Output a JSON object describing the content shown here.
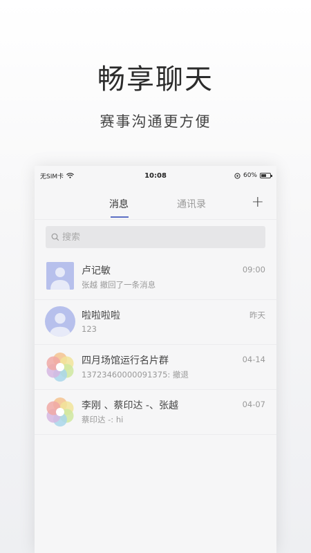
{
  "promo": {
    "title": "畅享聊天",
    "subtitle": "赛事沟通更方便"
  },
  "status_bar": {
    "carrier": "无SIM卡",
    "time": "10:08",
    "battery": "60%",
    "battery_level": 0.6
  },
  "tabs": {
    "messages": "消息",
    "contacts": "通讯录",
    "add_symbol": "+"
  },
  "search": {
    "placeholder": "搜索"
  },
  "conversations": [
    {
      "name": "卢记敏",
      "preview": "张越 撤回了一条消息",
      "time": "09:00",
      "avatar": "square-person-avatar"
    },
    {
      "name": "啦啦啦啦",
      "preview": "123",
      "time": "昨天",
      "avatar": "round-person-avatar"
    },
    {
      "name": "四月场馆运行名片群",
      "preview": "13723460000091375: 撤退",
      "time": "04-14",
      "avatar": "group-flower-avatar"
    },
    {
      "name": "李刚 、蔡印达 -、张越",
      "preview": "蔡印达 -: hi",
      "time": "04-07",
      "avatar": "group-flower-avatar"
    }
  ],
  "colors": {
    "accent": "#5b6ec4",
    "avatar_blue": "#b7c0ec",
    "flower_petals": [
      "#f4c38f",
      "#f1e49a",
      "#cfe7a0",
      "#a9d6ea",
      "#d6b7e2",
      "#f0a9a6"
    ]
  }
}
